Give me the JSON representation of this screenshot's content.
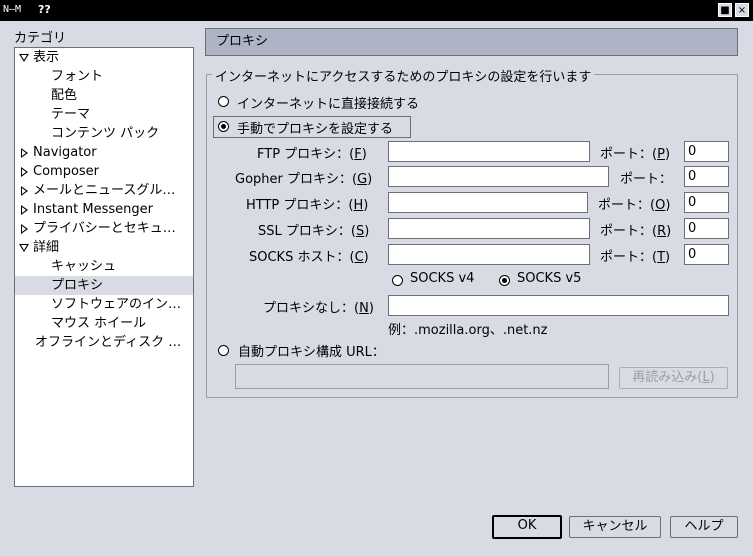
{
  "window": {
    "title": "??",
    "logo_text": "N–M",
    "controls": {
      "restore": "■",
      "close": "×"
    }
  },
  "sidebar": {
    "label": "カテゴリ",
    "items": [
      {
        "label": "表示",
        "level": 0,
        "twisty": "open"
      },
      {
        "label": "フォント",
        "level": 1
      },
      {
        "label": "配色",
        "level": 1
      },
      {
        "label": "テーマ",
        "level": 1
      },
      {
        "label": "コンテンツ パック",
        "level": 1
      },
      {
        "label": "Navigator",
        "level": 0,
        "twisty": "closed"
      },
      {
        "label": "Composer",
        "level": 0,
        "twisty": "closed"
      },
      {
        "label": "メールとニュースグル…",
        "level": 0,
        "twisty": "closed"
      },
      {
        "label": "Instant Messenger",
        "level": 0,
        "twisty": "closed"
      },
      {
        "label": "プライバシーとセキュ…",
        "level": 0,
        "twisty": "closed"
      },
      {
        "label": "詳細",
        "level": 0,
        "twisty": "open"
      },
      {
        "label": "キャッシュ",
        "level": 1
      },
      {
        "label": "プロキシ",
        "level": 1,
        "selected": true
      },
      {
        "label": "ソフトウェアのイン…",
        "level": 1
      },
      {
        "label": "マウス ホイール",
        "level": 1
      },
      {
        "label": "オフラインとディスク …",
        "level": 0
      }
    ]
  },
  "panel": {
    "header": "プロキシ",
    "group_title": "インターネットにアクセスするためのプロキシの設定を行います",
    "direct_label": "インターネットに直接接続する",
    "manual_label": "手動でプロキシを設定する",
    "port_label": "ポート：",
    "proxies": {
      "ftp": {
        "label": "FTP プロキシ：",
        "key": "F",
        "value": "",
        "port_key": "P",
        "port": "0"
      },
      "gopher": {
        "label": "Gopher プロキシ：",
        "key": "G",
        "value": "",
        "port_key": "",
        "port": "0"
      },
      "http": {
        "label": "HTTP プロキシ：",
        "key": "H",
        "value": "",
        "port_key": "O",
        "port": "0"
      },
      "ssl": {
        "label": "SSL プロキシ：",
        "key": "S",
        "value": "",
        "port_key": "R",
        "port": "0"
      },
      "socks": {
        "label": "SOCKS ホスト：",
        "key": "C",
        "value": "",
        "port_key": "T",
        "port": "0"
      }
    },
    "socks_v4": "SOCKS v4",
    "socks_v5": "SOCKS v5",
    "no_proxy_label": "プロキシなし：",
    "no_proxy_key": "N",
    "no_proxy_value": "",
    "no_proxy_example": "例：.mozilla.org、.net.nz",
    "auto_label": "自動プロキシ構成 URL：",
    "auto_url": "",
    "reload_label": "再読み込み",
    "reload_key": "L"
  },
  "footer": {
    "ok": "OK",
    "cancel": "キャンセル",
    "help": "ヘルプ"
  }
}
